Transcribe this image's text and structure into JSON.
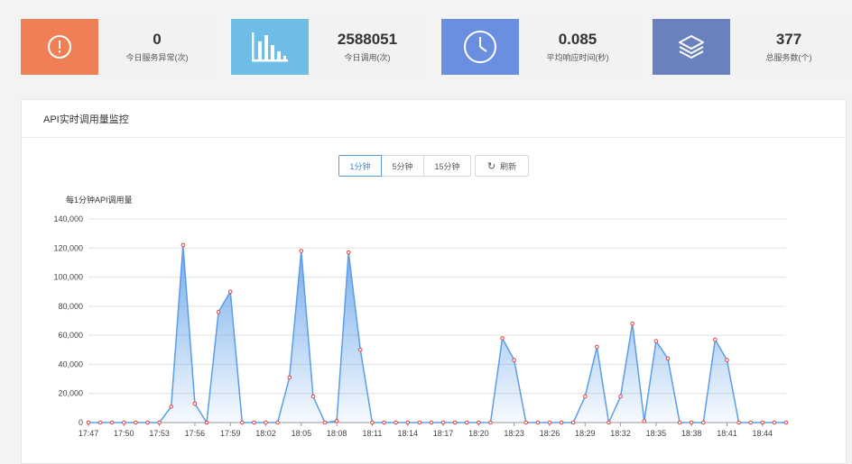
{
  "stats": [
    {
      "value": "0",
      "label": "今日服务异常(次)",
      "icon": "alert-circle-icon",
      "color": "#ef7f55"
    },
    {
      "value": "2588051",
      "label": "今日调用(次)",
      "icon": "bar-chart-icon",
      "color": "#6ebde6"
    },
    {
      "value": "0.085",
      "label": "平均响应时间(秒)",
      "icon": "clock-icon",
      "color": "#6a8fe0"
    },
    {
      "value": "377",
      "label": "总服务数(个)",
      "icon": "layers-icon",
      "color": "#6a81c0"
    }
  ],
  "panel": {
    "title": "API实时调用量监控",
    "buttons": [
      "1分钟",
      "5分钟",
      "15分钟"
    ],
    "active_button": "1分钟",
    "refresh_label": "刷新"
  },
  "chart_data": {
    "type": "area",
    "title": "每1分钟API调用量",
    "ylim": [
      0,
      140000
    ],
    "yticks": [
      0,
      20000,
      40000,
      60000,
      80000,
      100000,
      120000,
      140000
    ],
    "ytick_labels": [
      "0",
      "20,000",
      "40,000",
      "60,000",
      "80,000",
      "100,000",
      "120,000",
      "140,000"
    ],
    "xtick_labels": [
      "17:47",
      "17:50",
      "17:53",
      "17:56",
      "17:59",
      "18:02",
      "18:05",
      "18:08",
      "18:11",
      "18:14",
      "18:17",
      "18:20",
      "18:23",
      "18:26",
      "18:29",
      "18:32",
      "18:35",
      "18:38",
      "18:41",
      "18:44"
    ],
    "x": [
      "17:47",
      "17:48",
      "17:49",
      "17:50",
      "17:51",
      "17:52",
      "17:53",
      "17:54",
      "17:55",
      "17:56",
      "17:57",
      "17:58",
      "17:59",
      "18:00",
      "18:01",
      "18:02",
      "18:03",
      "18:04",
      "18:05",
      "18:06",
      "18:07",
      "18:08",
      "18:09",
      "18:10",
      "18:11",
      "18:12",
      "18:13",
      "18:14",
      "18:15",
      "18:16",
      "18:17",
      "18:18",
      "18:19",
      "18:20",
      "18:21",
      "18:22",
      "18:23",
      "18:24",
      "18:25",
      "18:26",
      "18:27",
      "18:28",
      "18:29",
      "18:30",
      "18:31",
      "18:32",
      "18:33",
      "18:34",
      "18:35",
      "18:36",
      "18:37",
      "18:38",
      "18:39",
      "18:40",
      "18:41",
      "18:42",
      "18:43",
      "18:44",
      "18:45",
      "18:46"
    ],
    "values": [
      0,
      0,
      0,
      0,
      0,
      0,
      0,
      11000,
      122000,
      13000,
      0,
      76000,
      90000,
      0,
      0,
      0,
      0,
      31000,
      118000,
      18000,
      0,
      1000,
      117000,
      50000,
      0,
      0,
      0,
      0,
      0,
      0,
      0,
      0,
      0,
      0,
      0,
      58000,
      43000,
      0,
      0,
      0,
      0,
      0,
      18000,
      52000,
      0,
      18000,
      68000,
      1000,
      56000,
      44000,
      0,
      0,
      0,
      57000,
      43000,
      0,
      0,
      0,
      0,
      0
    ],
    "grid": true,
    "line_color": "#5b9de8",
    "marker_color": "#e04040"
  }
}
